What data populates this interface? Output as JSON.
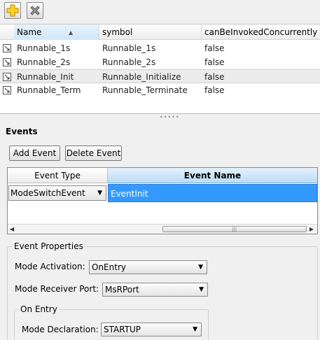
{
  "toolbar": {
    "add_icon": "plus-icon",
    "delete_icon": "x-icon"
  },
  "grid": {
    "columns": [
      "Name",
      "symbol",
      "canBeInvokedConcurrently"
    ],
    "rows": [
      {
        "name": "Runnable_1s",
        "symbol": "Runnable_1s",
        "concurrent": "false"
      },
      {
        "name": "Runnable_2s",
        "symbol": "Runnable_2s",
        "concurrent": "false"
      },
      {
        "name": "Runnable_Init",
        "symbol": "Runnable_Initialize",
        "concurrent": "false"
      },
      {
        "name": "Runnable_Term",
        "symbol": "Runnable_Terminate",
        "concurrent": "false"
      }
    ]
  },
  "events": {
    "title": "Events",
    "add_label": "Add Event",
    "delete_label": "Delete Event",
    "columns": [
      "Event Type",
      "Event Name"
    ],
    "rows": [
      {
        "type": "ModeSwitchEvent",
        "name": "EventInit"
      }
    ]
  },
  "properties": {
    "group_label": "Event Properties",
    "mode_activation_label": "Mode Activation:",
    "mode_activation_value": "OnEntry",
    "receiver_port_label": "Mode Receiver Port:",
    "receiver_port_value": "MsRPort",
    "on_entry_label": "On Entry",
    "mode_declaration_label": "Mode Declaration:",
    "mode_declaration_value": "STARTUP"
  },
  "colors": {
    "selection": "#3399ff",
    "header_selected": "#cfe6f8"
  }
}
